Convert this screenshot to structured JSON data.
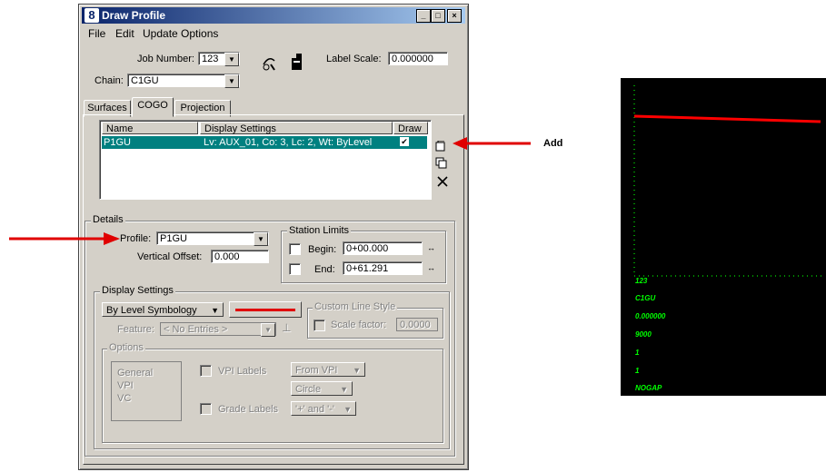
{
  "window": {
    "title": "Draw Profile",
    "controls": [
      "_",
      "□",
      "×"
    ]
  },
  "menu": [
    "File",
    "Edit",
    "Update Options"
  ],
  "job_number": {
    "label": "Job Number:",
    "value": "123"
  },
  "chain": {
    "label": "Chain:",
    "value": "C1GU"
  },
  "label_scale": {
    "label": "Label Scale:",
    "value": "0.000000"
  },
  "tabs": [
    {
      "label": "Surfaces",
      "active": false
    },
    {
      "label": "COGO",
      "active": true
    },
    {
      "label": "Projection",
      "active": false
    }
  ],
  "list": {
    "columns": [
      "Name",
      "Display Settings",
      "Draw"
    ],
    "rows": [
      {
        "name": "P1GU",
        "display": "Lv: AUX_01, Co: 3, Lc: 2, Wt: ByLevel",
        "draw": "✔"
      }
    ]
  },
  "side_icons": [
    "add-icon",
    "copy-icon",
    "delete-icon"
  ],
  "details": {
    "label": "Details",
    "profile_label": "Profile:",
    "profile_value": "P1GU",
    "voffset_label": "Vertical Offset:",
    "voffset_value": "0.000",
    "station_limits": "Station Limits",
    "begin_label": "Begin:",
    "begin_value": "0+00.000",
    "end_label": "End:",
    "end_value": "0+61.291"
  },
  "display_settings": {
    "label": "Display Settings",
    "symbology": "By Level Symbology",
    "line_color": "#e00000",
    "custom_line_style": "Custom Line Style",
    "scale_label": "Scale factor:",
    "scale_value": "0.0000",
    "feature_label": "Feature:",
    "feature_value": "< No Entries >",
    "options_label": "Options",
    "options_list": [
      "General",
      "VPI",
      "VC"
    ],
    "vpi_labels": "VPI Labels",
    "vpi_from": "From VPI",
    "vpi_shape": "Circle",
    "grade_labels": "Grade Labels",
    "grade_fmt": "'+' and '-'"
  },
  "annotations": {
    "add": "Add"
  },
  "plot": {
    "labels": [
      "123",
      "C1GU",
      "0.000000",
      "9000",
      "1",
      "1",
      "NOGAP"
    ],
    "line_color": "#ff0000",
    "grid_color": "#00c000"
  }
}
